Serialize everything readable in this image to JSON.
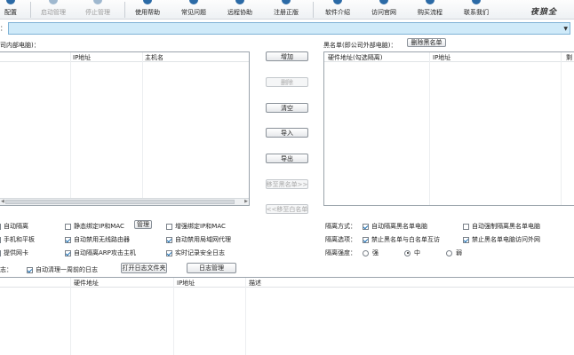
{
  "toolbar": {
    "items": [
      {
        "label": "配置",
        "state": "enabled"
      },
      {
        "label": "启动管理",
        "state": "disabled"
      },
      {
        "label": "停止管理",
        "state": "disabled"
      },
      {
        "label": "使用帮助",
        "state": "enabled"
      },
      {
        "label": "常见问题",
        "state": "enabled"
      },
      {
        "label": "远程协助",
        "state": "enabled"
      },
      {
        "label": "注册正版",
        "state": "enabled"
      },
      {
        "label": "软件介绍",
        "state": "enabled"
      },
      {
        "label": "访问官网",
        "state": "enabled"
      },
      {
        "label": "购买流程",
        "state": "enabled"
      },
      {
        "label": "联系我们",
        "state": "enabled"
      }
    ],
    "logo_text": "夜狼全",
    "icon_color": "#2b6aa6"
  },
  "filter": {
    "label": "：",
    "value": ""
  },
  "internal": {
    "caption": "司内部电脑)：",
    "columns": [
      "IP地址",
      "主机名"
    ]
  },
  "blacklist": {
    "caption": "黑名单(即公司外部电脑)：",
    "delete_button": "删除黑名单",
    "columns": [
      "硬件地址(勾选隔离)",
      "IP地址",
      "剩"
    ]
  },
  "middle_buttons": {
    "add": "增加",
    "delete": "删除",
    "clear": "清空",
    "import": "导入",
    "export": "导出",
    "move_to_black": "移至黑名单>>",
    "move_to_white": "<<移至白名单"
  },
  "left_options": {
    "auto_isolate": {
      "label": "自动隔离",
      "checked": false
    },
    "static_bind": {
      "label": "静态绑定IP和MAC",
      "checked": false
    },
    "manage_button": "管理",
    "enhanced_bind": {
      "label": "增强绑定IP和MAC",
      "checked": false
    },
    "phone_tablet": {
      "label": "手机和平板",
      "checked": false
    },
    "disable_wireless_router": {
      "label": "自动禁用无线路由器",
      "checked": true
    },
    "disable_lan_proxy": {
      "label": "自动禁用局域网代理",
      "checked": true
    },
    "multi_nic": {
      "label": "提供网卡",
      "checked": false
    },
    "isolate_arp": {
      "label": "自动隔离ARP攻击主机",
      "checked": true
    },
    "realtime_log": {
      "label": "实时记录安全日志",
      "checked": true
    }
  },
  "right_options": {
    "isolation_mode_label": "隔离方式：",
    "auto_isolate_black": {
      "label": "自动隔离黑名单电脑",
      "checked": true
    },
    "force_isolate_black": {
      "label": "自动强制隔离黑名单电脑",
      "checked": false
    },
    "isolation_options_label": "隔离选项：",
    "forbid_black_white": {
      "label": "禁止黑名单与白名单互访",
      "checked": true
    },
    "forbid_black_external": {
      "label": "禁止黑名单电脑访问外网",
      "checked": true
    },
    "strength_label": "隔离强度：",
    "strength": {
      "options": [
        "强",
        "中",
        "弱"
      ],
      "selected": "中"
    }
  },
  "log": {
    "caption": "志：",
    "auto_clear": {
      "label": "自动清理一周前的日志",
      "checked": true
    },
    "open_folder_button": "打开日志文件夹",
    "manage_button": "日志管理",
    "columns": [
      "硬件地址",
      "IP地址",
      "描述"
    ]
  }
}
